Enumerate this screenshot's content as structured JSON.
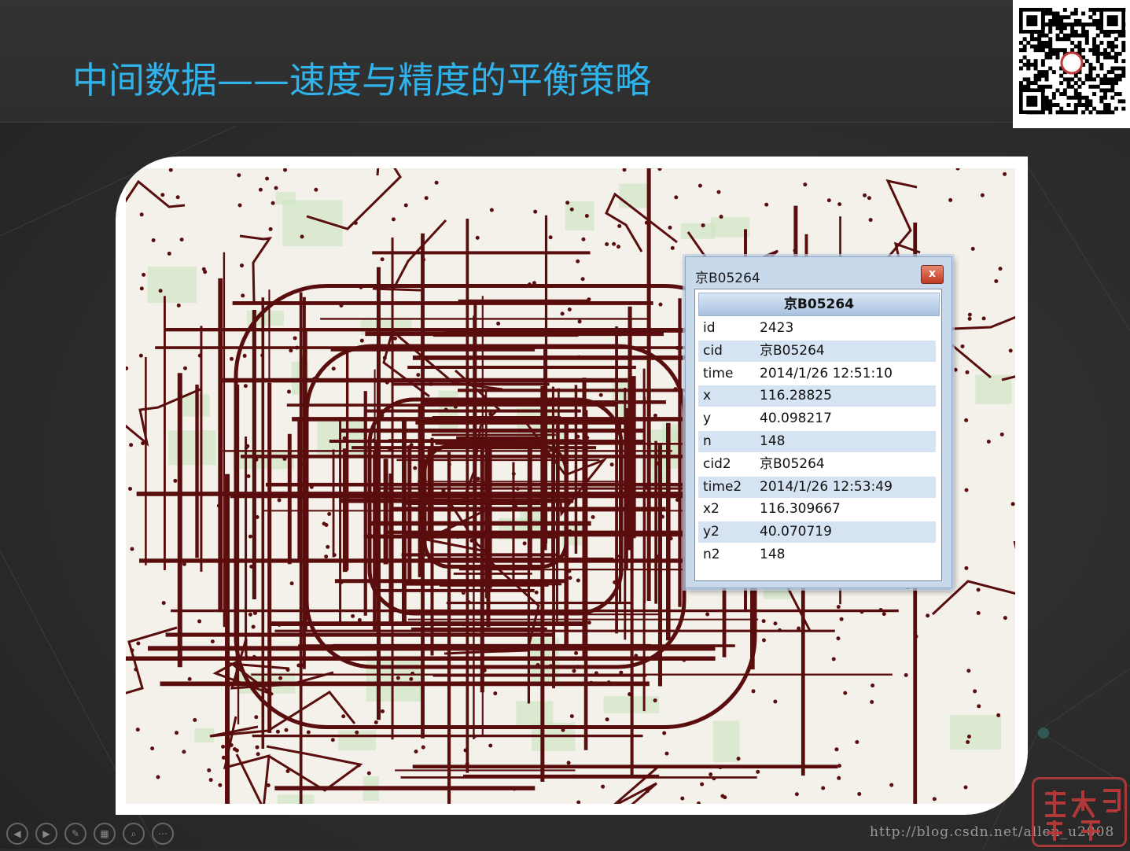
{
  "slide": {
    "title": "中间数据——速度与精度的平衡策略",
    "watermark_url": "http://blog.csdn.net/allen_u2008"
  },
  "popup": {
    "window_title": "京B05264",
    "close_label": "x",
    "header": "京B05264",
    "rows": [
      {
        "key": "id",
        "value": "2423"
      },
      {
        "key": "cid",
        "value": "京B05264"
      },
      {
        "key": "time",
        "value": "2014/1/26 12:51:10"
      },
      {
        "key": "x",
        "value": "116.28825"
      },
      {
        "key": "y",
        "value": "40.098217"
      },
      {
        "key": "n",
        "value": "148"
      },
      {
        "key": "cid2",
        "value": "京B05264"
      },
      {
        "key": "time2",
        "value": "2014/1/26 12:53:49"
      },
      {
        "key": "x2",
        "value": "116.309667"
      },
      {
        "key": "y2",
        "value": "40.070719"
      },
      {
        "key": "n2",
        "value": "148"
      }
    ]
  },
  "controls": [
    {
      "name": "prev-icon",
      "glyph": "◀"
    },
    {
      "name": "next-icon",
      "glyph": "▶"
    },
    {
      "name": "pen-icon",
      "glyph": "✎"
    },
    {
      "name": "slides-icon",
      "glyph": "▦"
    },
    {
      "name": "zoom-icon",
      "glyph": "⌕"
    },
    {
      "name": "more-icon",
      "glyph": "⋯"
    }
  ],
  "seal": {
    "chars": "大象数据"
  },
  "colors": {
    "title": "#2fb3ea",
    "track": "#5a0d0d",
    "popup_alt_row": "#d6e3f3"
  }
}
